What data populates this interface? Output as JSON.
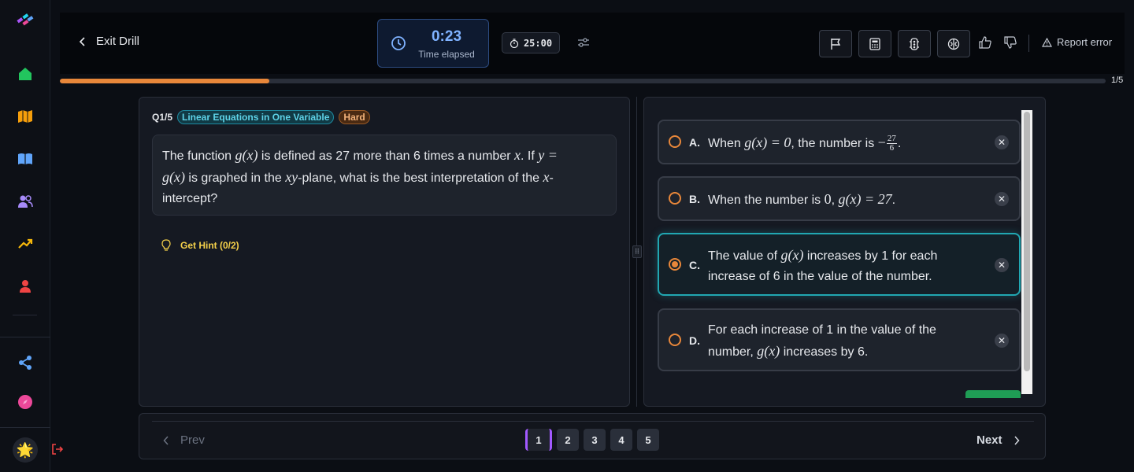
{
  "colors": {
    "accent_orange": "#e8873a",
    "accent_teal": "#21a7b2",
    "accent_blue": "#7fb2ff",
    "hint_yellow": "#f5d14a",
    "page_current_border": "#a259ff"
  },
  "sidebar": {
    "items": [
      {
        "icon": "home-icon",
        "color": "#22c55e"
      },
      {
        "icon": "map-icon",
        "color": "#f59e0b"
      },
      {
        "icon": "book-icon",
        "color": "#60a5fa"
      },
      {
        "icon": "users-icon",
        "color": "#a78bfa"
      },
      {
        "icon": "trending-up-icon",
        "color": "#f5b70b"
      },
      {
        "icon": "user-icon",
        "color": "#ef4444"
      }
    ],
    "secondary": [
      {
        "icon": "share-icon",
        "color": "#60a5fa"
      },
      {
        "icon": "compass-icon",
        "color": "#ec4899"
      }
    ],
    "avatar_emoji": "🌟"
  },
  "header": {
    "exit_label": "Exit Drill",
    "timer_value": "0:23",
    "timer_label": "Time elapsed",
    "time_limit": "25:00",
    "report_label": "Report error"
  },
  "progress": {
    "fraction": 0.2,
    "label": "1/5"
  },
  "question": {
    "number": "Q1/5",
    "topic": "Linear Equations in One Variable",
    "difficulty": "Hard",
    "hint_label": "Get Hint (0/2)",
    "text_parts": [
      "The function ",
      "g(x)",
      " is defined as 27 more than 6 times a number ",
      "x",
      ". If ",
      "y =",
      "g(x)",
      " is graphed in the ",
      "xy",
      "-plane, what is the best interpretation of the ",
      "x",
      "-",
      "intercept?"
    ]
  },
  "options": [
    {
      "letter": "A.",
      "selected": false,
      "parts": [
        "When ",
        "g(x) = 0",
        ", the number is ",
        "−",
        "27",
        "6",
        "."
      ]
    },
    {
      "letter": "B.",
      "selected": false,
      "parts": [
        "When the number is ",
        "0",
        ", ",
        "g(x) = 27",
        "."
      ]
    },
    {
      "letter": "C.",
      "selected": true,
      "parts": [
        "The value of ",
        "g(x)",
        " increases by 1 for each",
        "increase of 6 in the value of the number."
      ]
    },
    {
      "letter": "D.",
      "selected": false,
      "parts": [
        "For each increase of 1 in the value of the",
        "number, ",
        "g(x)",
        " increases by 6."
      ]
    }
  ],
  "nav": {
    "prev_label": "Prev",
    "next_label": "Next",
    "pages": [
      "1",
      "2",
      "3",
      "4",
      "5"
    ],
    "current_page": "1"
  }
}
